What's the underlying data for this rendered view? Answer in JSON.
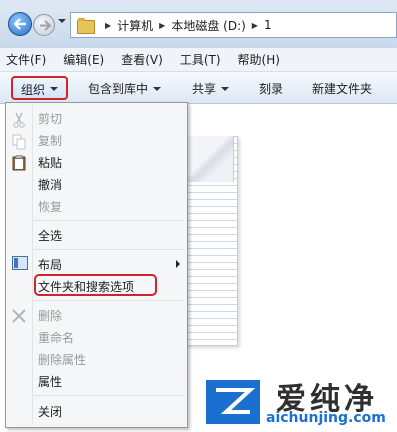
{
  "address_bar": {
    "breadcrumbs": [
      "计算机",
      "本地磁盘 (D:)",
      "1"
    ]
  },
  "menubar": [
    "文件(F)",
    "编辑(E)",
    "查看(V)",
    "工具(T)",
    "帮助(H)"
  ],
  "commandbar": {
    "organize": "组织",
    "include_in_library": "包含到库中",
    "share": "共享",
    "burn": "刻录",
    "new_folder": "新建文件夹"
  },
  "organize_menu": {
    "cut": "剪切",
    "copy": "复制",
    "paste": "粘贴",
    "undo": "撤消",
    "redo": "恢复",
    "select_all": "全选",
    "layout": "布局",
    "folder_options": "文件夹和搜索选项",
    "delete": "删除",
    "rename": "重命名",
    "remove_properties": "删除属性",
    "properties": "属性",
    "close": "关闭"
  },
  "watermark": {
    "title": "爱纯净",
    "url": "aichunjing.com"
  },
  "colors": {
    "highlight": "#d2222d",
    "brand": "#1b6fd1"
  }
}
